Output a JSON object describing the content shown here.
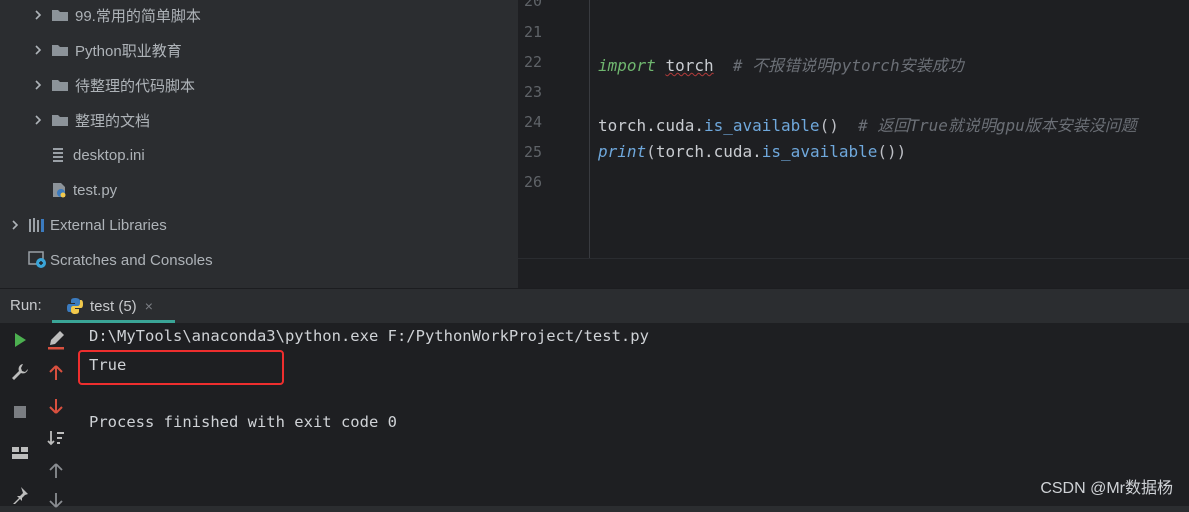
{
  "project_tree": {
    "items": [
      {
        "label": "99.常用的简单脚本",
        "kind": "folder"
      },
      {
        "label": "Python职业教育",
        "kind": "folder"
      },
      {
        "label": "待整理的代码脚本",
        "kind": "folder"
      },
      {
        "label": "整理的文档",
        "kind": "folder"
      },
      {
        "label": "desktop.ini",
        "kind": "ini-file"
      },
      {
        "label": "test.py",
        "kind": "python-file"
      },
      {
        "label": "External Libraries",
        "kind": "libraries"
      },
      {
        "label": "Scratches and Consoles",
        "kind": "scratches"
      }
    ]
  },
  "editor": {
    "line_numbers": [
      "20",
      "21",
      "22",
      "23",
      "24",
      "25",
      "26"
    ],
    "lines": [
      {
        "ln": "22",
        "keyword": "import",
        "module": "torch",
        "comment": "# 不报错说明pytorch安装成功"
      },
      {
        "ln": "24",
        "obj": "torch.cuda.",
        "func": "is_available",
        "paren": "()",
        "comment": "# 返回True就说明gpu版本安装没问题"
      },
      {
        "ln": "25",
        "builtin": "print",
        "paren_open": "(",
        "obj": "torch.cuda.",
        "func": "is_available",
        "paren_close": "())"
      }
    ]
  },
  "run_panel": {
    "label": "Run:",
    "tab_label": "test (5)",
    "tab_close": "×"
  },
  "console": {
    "command_line": "D:\\MyTools\\anaconda3\\python.exe F:/PythonWorkProject/test.py",
    "result": "True",
    "exit_message": "Process finished with exit code 0"
  },
  "watermark": "CSDN @Mr数据杨",
  "colors": {
    "accent_tab": "#3aa597",
    "highlight_box": "#ee2e2e",
    "run_green": "#4caf50",
    "arrow_red": "#d9503f"
  }
}
